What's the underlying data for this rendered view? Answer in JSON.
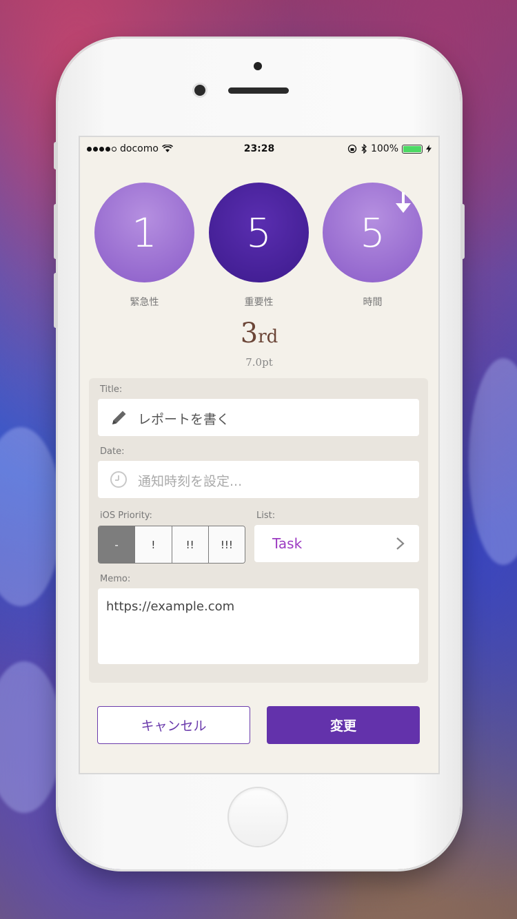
{
  "status_bar": {
    "carrier": "docomo",
    "time": "23:28",
    "battery": "100%"
  },
  "scores": [
    {
      "value": "1",
      "label": "緊急性"
    },
    {
      "value": "5",
      "label": "重要性"
    },
    {
      "value": "5",
      "label": "時間"
    }
  ],
  "rank": {
    "number": "3",
    "suffix": "rd",
    "points": "7.0pt"
  },
  "form": {
    "title_label": "Title:",
    "title_value": "レポートを書く",
    "date_label": "Date:",
    "date_placeholder": "通知時刻を設定...",
    "priority_label": "iOS Priority:",
    "priority_options": [
      "-",
      "!",
      "!!",
      "!!!"
    ],
    "list_label": "List:",
    "list_value": "Task",
    "memo_label": "Memo:",
    "memo_value": "https://example.com"
  },
  "buttons": {
    "cancel": "キャンセル",
    "save": "変更"
  },
  "colors": {
    "accent": "#6332ab",
    "task": "#9c3bc2"
  }
}
